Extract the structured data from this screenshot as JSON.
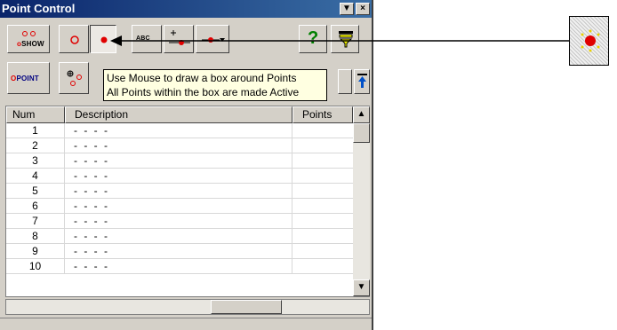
{
  "window": {
    "title": "Point Control"
  },
  "toolbar1": {
    "show_label": "SHOW",
    "abc_label": "ABC",
    "help_label": "?"
  },
  "toolbar2": {
    "point_label": "POINT"
  },
  "tooltip": {
    "line1": "Use Mouse to draw a box around Points",
    "line2": "All Points within the box are made Active"
  },
  "table": {
    "headers": [
      "Num",
      "Description",
      "Points"
    ],
    "rows": [
      {
        "num": "1",
        "desc": "- - - -",
        "points": ""
      },
      {
        "num": "2",
        "desc": "- - - -",
        "points": ""
      },
      {
        "num": "3",
        "desc": "- - - -",
        "points": ""
      },
      {
        "num": "4",
        "desc": "- - - -",
        "points": ""
      },
      {
        "num": "5",
        "desc": "- - - -",
        "points": ""
      },
      {
        "num": "6",
        "desc": "- - - -",
        "points": ""
      },
      {
        "num": "7",
        "desc": "- - - -",
        "points": ""
      },
      {
        "num": "8",
        "desc": "- - - -",
        "points": ""
      },
      {
        "num": "9",
        "desc": "- - - -",
        "points": ""
      },
      {
        "num": "10",
        "desc": "- - - -",
        "points": ""
      }
    ]
  },
  "colors": {
    "title_bar": "#0a246a",
    "point_red": "#e00000",
    "tooltip_bg": "#ffffe1",
    "face": "#d4d0c8"
  },
  "icons": [
    "show-points-icon",
    "hollow-point-icon",
    "solid-point-icon",
    "label-abc-icon",
    "add-point-icon",
    "point-dropdown-icon",
    "help-icon",
    "filter-icon",
    "point-mode-icon",
    "multi-point-icon",
    "sample-point-icon"
  ]
}
